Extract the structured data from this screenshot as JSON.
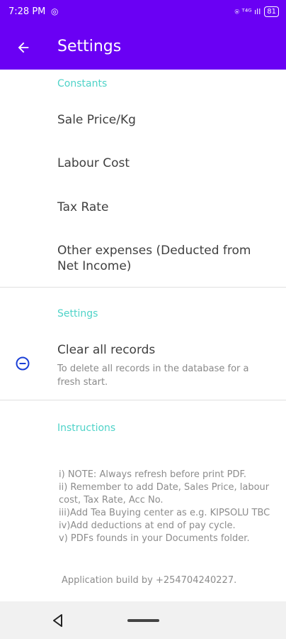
{
  "status_bar": {
    "time": "7:28 PM",
    "left_icon": "whatsapp-icon",
    "right_text": "⍟ ᵀ⁴ᴳ ıll",
    "battery": "81"
  },
  "app_bar": {
    "title": "Settings",
    "back_icon": "arrow-left-icon"
  },
  "constants": {
    "header": "Constants",
    "items": [
      "Sale Price/Kg",
      "Labour Cost",
      "Tax Rate",
      "Other expenses (Deducted from Net Income)"
    ]
  },
  "settings": {
    "header": "Settings",
    "clear": {
      "title": "Clear all records",
      "subtitle": "To delete all records in the database for a fresh start.",
      "icon": "minus-circle-icon"
    }
  },
  "instructions": {
    "header": "Instructions",
    "lines": [
      "i) NOTE: Always refresh before print PDF.",
      "ii) Remember to add Date, Sales Price, labour cost, Tax Rate, Acc No.",
      "iii)Add Tea Buying center as e.g. KIPSOLU TBC",
      "iv)Add deductions at end of pay cycle.",
      "v) PDFs founds in your Documents folder."
    ],
    "credit": "Application build by +254704240227."
  },
  "colors": {
    "primary": "#6a00f4",
    "accent": "#4fd3c8",
    "icon": "#1a3fd6"
  },
  "nav": {
    "back_icon": "triangle-back-icon",
    "home_icon": "home-pill-icon"
  }
}
